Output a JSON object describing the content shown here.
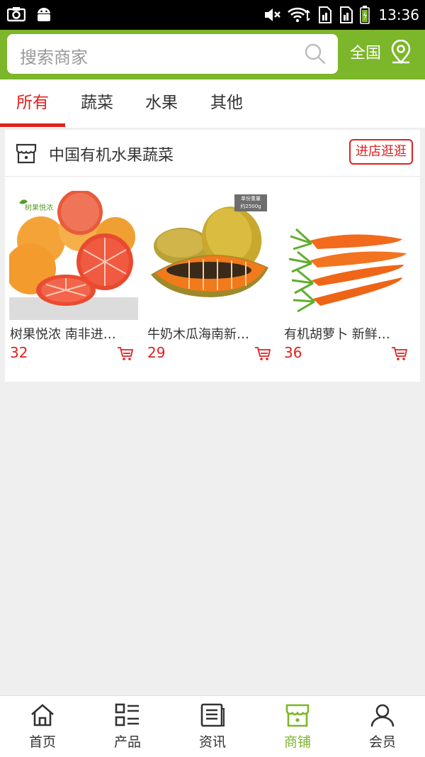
{
  "status_bar": {
    "time": "13:36"
  },
  "header": {
    "search_placeholder": "搜索商家",
    "region": "全国"
  },
  "tabs": [
    {
      "label": "所有",
      "active": true
    },
    {
      "label": "蔬菜",
      "active": false
    },
    {
      "label": "水果",
      "active": false
    },
    {
      "label": "其他",
      "active": false
    }
  ],
  "store": {
    "name": "中国有机水果蔬菜",
    "visit_label": "进店逛逛",
    "products": [
      {
        "name": "树果悦浓 南非进…",
        "price": "32",
        "image": "grapefruit",
        "brand_text": "树果悦浓"
      },
      {
        "name": "牛奶木瓜海南新…",
        "price": "29",
        "image": "papaya",
        "weight_badge": [
          "单份重量",
          "约2500g"
        ]
      },
      {
        "name": "有机胡萝卜 新鲜…",
        "price": "36",
        "image": "carrot"
      }
    ]
  },
  "bottom_nav": [
    {
      "label": "首页",
      "icon": "home-icon",
      "active": false
    },
    {
      "label": "产品",
      "icon": "grid-list-icon",
      "active": false
    },
    {
      "label": "资讯",
      "icon": "news-icon",
      "active": false
    },
    {
      "label": "商铺",
      "icon": "shop-icon",
      "active": true
    },
    {
      "label": "会员",
      "icon": "user-icon",
      "active": false
    }
  ],
  "colors": {
    "brand_green": "#7cb62a",
    "accent_red": "#e02020"
  }
}
